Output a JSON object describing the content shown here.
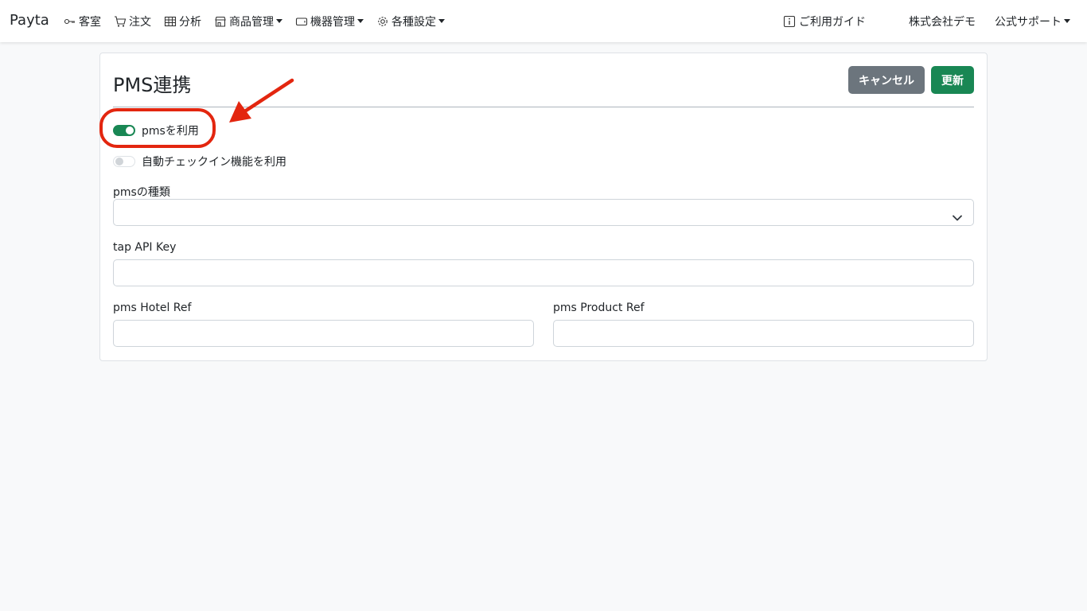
{
  "navbar": {
    "brand": "Payta",
    "items": [
      {
        "label": "客室",
        "icon": "key-icon",
        "dropdown": false
      },
      {
        "label": "注文",
        "icon": "cart-icon",
        "dropdown": false
      },
      {
        "label": "分析",
        "icon": "table-icon",
        "dropdown": false
      },
      {
        "label": "商品管理",
        "icon": "shop-icon",
        "dropdown": true
      },
      {
        "label": "機器管理",
        "icon": "device-icon",
        "dropdown": true
      },
      {
        "label": "各種設定",
        "icon": "gear-icon",
        "dropdown": true
      }
    ],
    "guide": {
      "label": "ご利用ガイド",
      "icon": "info-icon"
    },
    "company": "株式会社デモ",
    "support": {
      "label": "公式サポート",
      "dropdown": true
    }
  },
  "page": {
    "title": "PMS連携",
    "cancel_label": "キャンセル",
    "update_label": "更新"
  },
  "form": {
    "use_pms": {
      "label": "pmsを利用",
      "checked": true
    },
    "auto_checkin": {
      "label": "自動チェックイン機能を利用",
      "checked": false
    },
    "pms_type": {
      "label": "pmsの種類",
      "value": ""
    },
    "tap_api_key": {
      "label": "tap API Key",
      "value": ""
    },
    "pms_hotel_ref": {
      "label": "pms Hotel Ref",
      "value": ""
    },
    "pms_product_ref": {
      "label": "pms Product Ref",
      "value": ""
    }
  },
  "colors": {
    "primary_green": "#198754",
    "secondary_gray": "#6c757d",
    "annotation_red": "#e3260f",
    "background": "#f8f9fa"
  }
}
